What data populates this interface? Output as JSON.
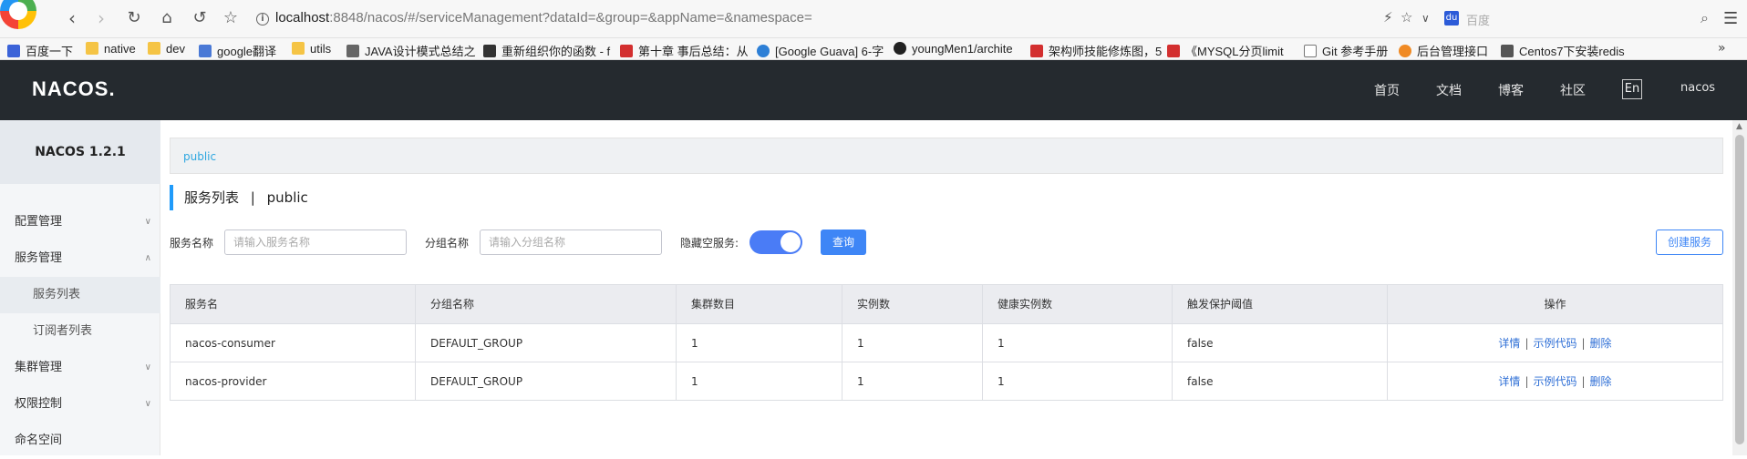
{
  "browser": {
    "url_host": "localhost",
    "url_rest": ":8848/nacos/#/serviceManagement?dataId=&group=&appName=&namespace=",
    "search_placeholder": "百度",
    "bookmarks": [
      "百度一下",
      "native",
      "dev",
      "google翻译",
      "utils",
      "JAVA设计模式总结之",
      "重新组织你的函数 - f",
      "第十章 事后总结：从",
      "[Google Guava] 6-字",
      "youngMen1/archite",
      "架构师技能修炼图，5",
      "《MYSQL分页limit",
      "Git 参考手册",
      "后台管理接口",
      "Centos7下安装redis"
    ]
  },
  "header": {
    "logo": "NACOS.",
    "nav": [
      "首页",
      "文档",
      "博客",
      "社区"
    ],
    "lang": "En",
    "user": "nacos"
  },
  "sidebar": {
    "title": "NACOS 1.2.1",
    "items": [
      {
        "label": "配置管理"
      },
      {
        "label": "服务管理"
      },
      {
        "label": "服务列表"
      },
      {
        "label": "订阅者列表"
      },
      {
        "label": "集群管理"
      },
      {
        "label": "权限控制"
      },
      {
        "label": "命名空间"
      }
    ]
  },
  "main": {
    "breadcrumb": "public",
    "title": "服务列表",
    "title_sep": "|",
    "namespace": "public",
    "form": {
      "service_name_label": "服务名称",
      "service_name_placeholder": "请输入服务名称",
      "group_name_label": "分组名称",
      "group_name_placeholder": "请输入分组名称",
      "hide_empty_label": "隐藏空服务:",
      "hide_empty_on": true,
      "query_button": "查询",
      "create_button": "创建服务"
    },
    "table": {
      "headers": [
        "服务名",
        "分组名称",
        "集群数目",
        "实例数",
        "健康实例数",
        "触发保护阈值",
        "操作"
      ],
      "rows": [
        [
          "nacos-consumer",
          "DEFAULT_GROUP",
          "1",
          "1",
          "1",
          "false"
        ],
        [
          "nacos-provider",
          "DEFAULT_GROUP",
          "1",
          "1",
          "1",
          "false"
        ]
      ],
      "actions": [
        "详情",
        "示例代码",
        "删除"
      ],
      "action_sep": "|"
    }
  }
}
